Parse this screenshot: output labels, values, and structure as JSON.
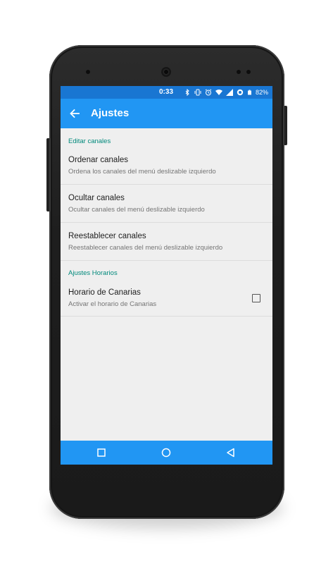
{
  "status_bar": {
    "time": "0:33",
    "battery_percent": "82%",
    "icons": [
      "bluetooth-icon",
      "vibrate-icon",
      "alarm-icon",
      "wifi-icon",
      "signal-icon",
      "data-saver-icon",
      "battery-icon"
    ]
  },
  "app_bar": {
    "title": "Ajustes",
    "back_icon": "arrow-left-icon"
  },
  "sections": [
    {
      "header": "Editar canales",
      "items": [
        {
          "title": "Ordenar canales",
          "summary": "Ordena los canales del menú deslizable izquierdo"
        },
        {
          "title": "Ocultar canales",
          "summary": "Ocultar canales del menú deslizable izquierdo"
        },
        {
          "title": "Reestablecer canales",
          "summary": "Reestablecer canales del menú deslizable izquierdo"
        }
      ]
    },
    {
      "header": "Ajustes Horarios",
      "items": [
        {
          "title": "Horario de Canarias",
          "summary": "Activar el horario de Canarias",
          "checked": false
        }
      ]
    }
  ],
  "nav_bar": {
    "buttons": [
      "recent-apps-icon",
      "home-icon",
      "back-triangle-icon"
    ]
  },
  "colors": {
    "status_bar": "#1976d2",
    "app_bar": "#2196f3",
    "section_header": "#00897b",
    "background": "#efefef"
  }
}
